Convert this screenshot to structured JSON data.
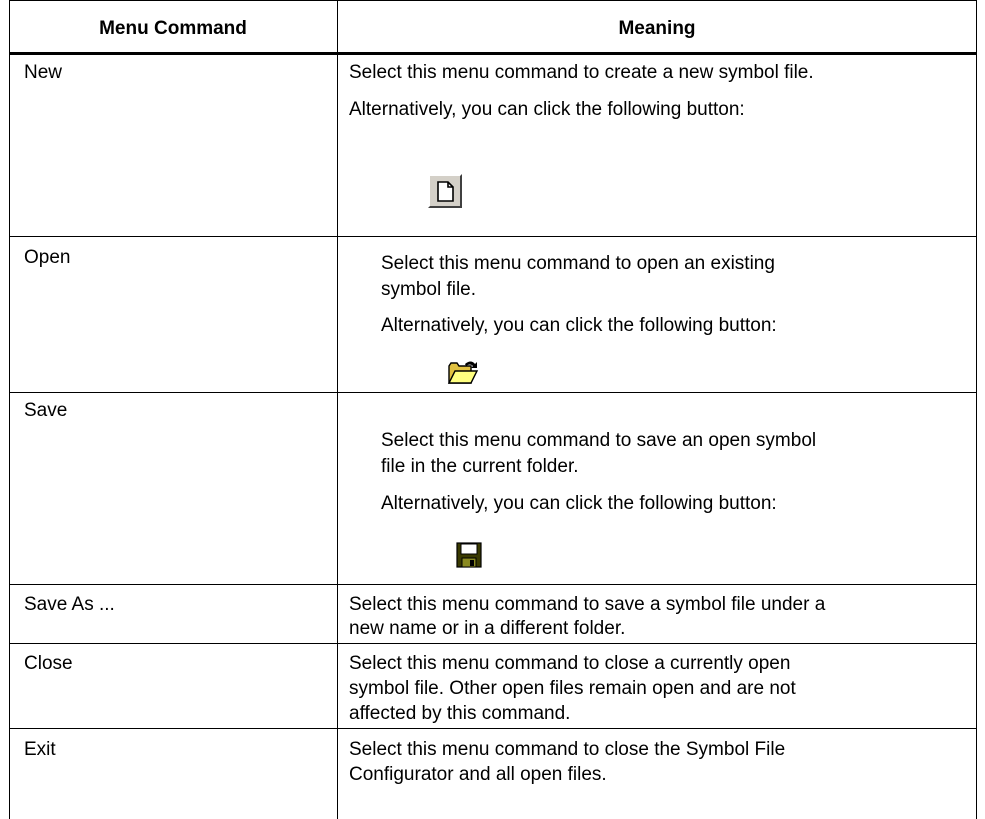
{
  "table": {
    "headers": {
      "command": "Menu Command",
      "meaning": "Meaning"
    },
    "rows": [
      {
        "command": "New",
        "lines": [
          "Select this menu command to create a new symbol file.",
          "Alternatively, you can click the following button:"
        ],
        "button_icon": "new-document-icon"
      },
      {
        "command": "Open",
        "lines": [
          "Select this menu command to open an existing",
          "symbol file.",
          "Alternatively, you can click the following button:"
        ],
        "button_icon": "open-folder-icon"
      },
      {
        "command": "Save",
        "lines": [
          "Select this menu command to save an open symbol",
          "file in the current folder.",
          "Alternatively, you can click the following button:"
        ],
        "button_icon": "floppy-disk-icon"
      },
      {
        "command": "Save As ...",
        "lines": [
          "Select this menu command to save a symbol file under a",
          "new name or in a different folder."
        ]
      },
      {
        "command": "Close",
        "lines": [
          "Select this menu command to close a currently open",
          "symbol file. Other open files remain open and are not",
          "affected by this command."
        ]
      },
      {
        "command": "Exit",
        "lines": [
          "Select this menu command to close the Symbol File",
          "Configurator and all open files."
        ]
      }
    ]
  }
}
